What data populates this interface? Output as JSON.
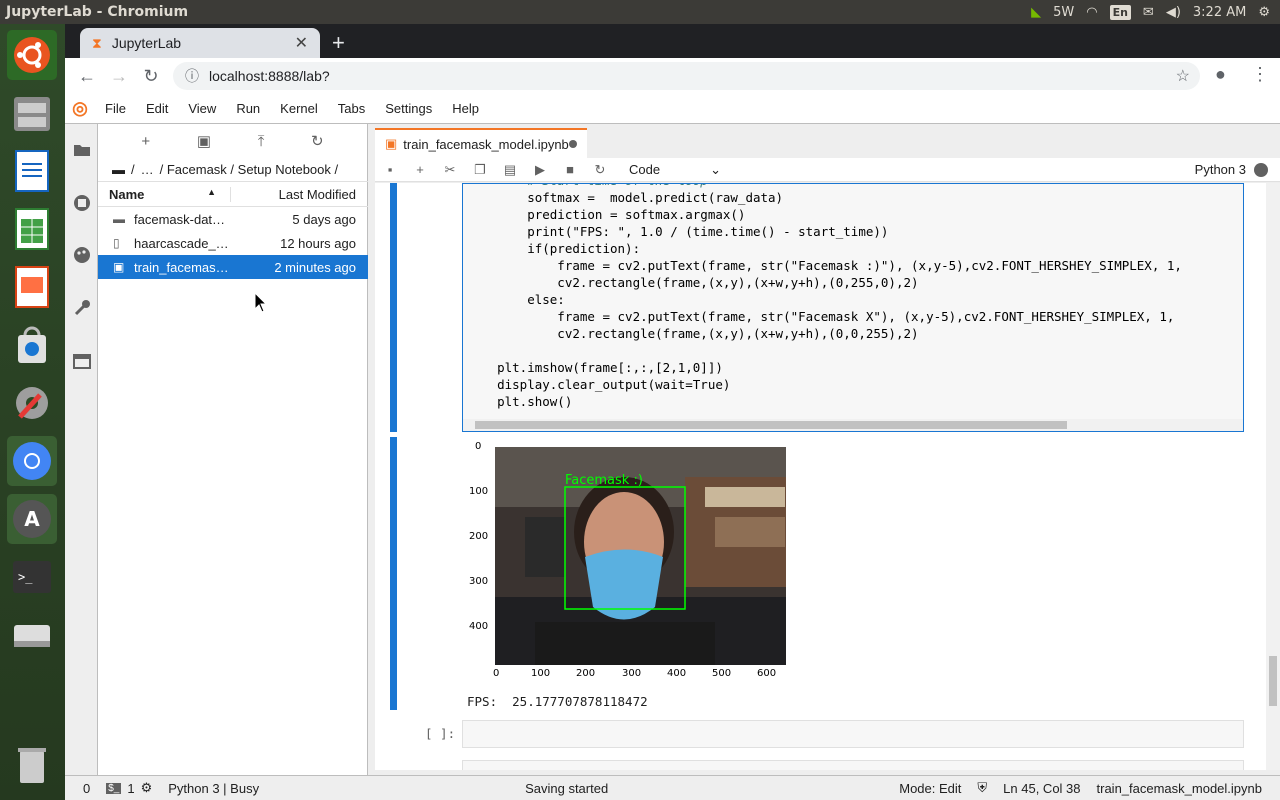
{
  "window_title": "JupyterLab - Chromium",
  "tray": {
    "nvidia_label": "5W",
    "lang": "En",
    "time": "3:22 AM"
  },
  "browser": {
    "tab_title": "JupyterLab",
    "url": "localhost:8888/lab?"
  },
  "menu": [
    "File",
    "Edit",
    "View",
    "Run",
    "Kernel",
    "Tabs",
    "Settings",
    "Help"
  ],
  "filebrowser": {
    "breadcrumb": [
      "/",
      "…",
      "/ Facemask / Setup Notebook /"
    ],
    "col_name": "Name",
    "col_modified": "Last Modified",
    "files": [
      {
        "name": "facemask-dat…",
        "modified": "5 days ago",
        "icon": "folder-icon"
      },
      {
        "name": "haarcascade_…",
        "modified": "12 hours ago",
        "icon": "file-icon"
      },
      {
        "name": "train_facemas…",
        "modified": "2 minutes ago",
        "icon": "notebook-icon"
      }
    ]
  },
  "notebook": {
    "tab_title": "train_facemask_model.ipynb",
    "cell_type": "Code",
    "kernel": "Python 3",
    "code_lines": [
      "        # Start time of the loop",
      "        softmax =  model.predict(raw_data)",
      "        prediction = softmax.argmax()",
      "        print(\"FPS: \", 1.0 / (time.time() - start_time))",
      "        if(prediction):",
      "            frame = cv2.putText(frame, str(\"Facemask :)\"), (x,y-5),cv2.FONT_HERSHEY_SIMPLEX, 1,",
      "            cv2.rectangle(frame,(x,y),(x+w,y+h),(0,255,0),2)",
      "        else:",
      "            frame = cv2.putText(frame, str(\"Facemask X\"), (x,y-5),cv2.FONT_HERSHEY_SIMPLEX, 1,",
      "            cv2.rectangle(frame,(x,y),(x+w,y+h),(0,0,255),2)",
      "",
      "    plt.imshow(frame[:,:,[2,1,0]])",
      "    display.clear_output(wait=True)",
      "    plt.show()"
    ],
    "plot": {
      "yticks": [
        "0",
        "100",
        "200",
        "300",
        "400"
      ],
      "xticks": [
        "0",
        "100",
        "200",
        "300",
        "400",
        "500",
        "600"
      ],
      "overlay_text": "Facemask :)"
    },
    "output_text": "FPS:  25.177707878118472",
    "empty_prompt": "[ ]:"
  },
  "status": {
    "left_count": "0",
    "terminal_count": "1",
    "kernel_status": "Python 3 | Busy",
    "message": "Saving started",
    "mode": "Mode: Edit",
    "position": "Ln 45, Col 38",
    "filename": "train_facemask_model.ipynb"
  }
}
